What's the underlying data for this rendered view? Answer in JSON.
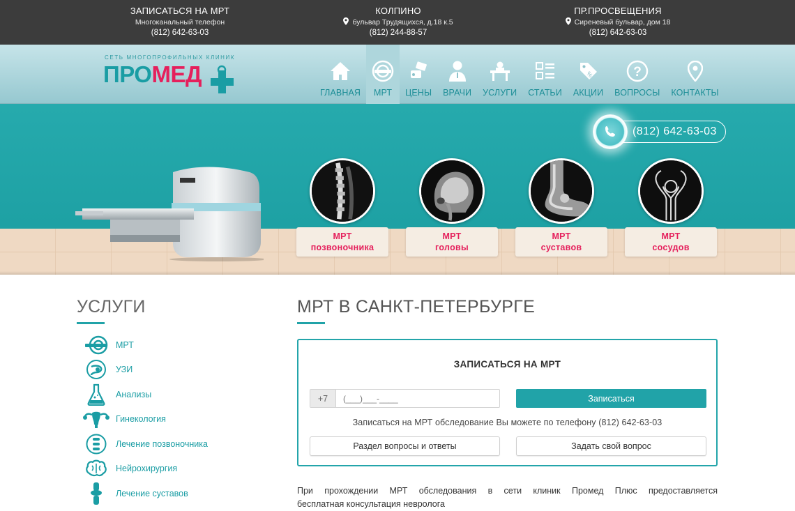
{
  "topbar": {
    "col1": {
      "title": "ЗАПИСАТЬСЯ НА МРТ",
      "line2": "Многоканальный телефон",
      "phone": "(812) 642-63-03"
    },
    "col2": {
      "title": "КОЛПИНО",
      "address": "бульвар Трудящихся, д.18 к.5",
      "phone": "(812) 244-88-57"
    },
    "col3": {
      "title": "ПР.ПРОСВЕЩЕНИЯ",
      "address": "Сиреневый бульвар, дом 18",
      "phone": "(812) 642-63-03"
    }
  },
  "logo": {
    "subtitle": "СЕТЬ МНОГОПРОФИЛЬНЫХ КЛИНИК",
    "part1": "ПРО",
    "part2": "МЕД"
  },
  "nav": {
    "items": [
      {
        "label": "ГЛАВНАЯ",
        "icon": "home-icon"
      },
      {
        "label": "МРТ",
        "icon": "mri-icon",
        "active": true
      },
      {
        "label": "ЦЕНЫ",
        "icon": "price-icon"
      },
      {
        "label": "ВРАЧИ",
        "icon": "doctor-icon"
      },
      {
        "label": "УСЛУГИ",
        "icon": "services-icon"
      },
      {
        "label": "СТАТЬИ",
        "icon": "articles-icon"
      },
      {
        "label": "АКЦИИ",
        "icon": "discount-icon"
      },
      {
        "label": "ВОПРОСЫ",
        "icon": "question-icon"
      },
      {
        "label": "КОНТАКТЫ",
        "icon": "location-icon"
      }
    ]
  },
  "hero": {
    "phone": "(812) 642-63-03",
    "cards": [
      {
        "line1": "МРТ",
        "line2": "позвоночника"
      },
      {
        "line1": "МРТ",
        "line2": "головы"
      },
      {
        "line1": "МРТ",
        "line2": "суставов"
      },
      {
        "line1": "МРТ",
        "line2": "сосудов"
      }
    ]
  },
  "sidebar": {
    "title": "УСЛУГИ",
    "items": [
      {
        "label": "МРТ",
        "icon": "mri-icon"
      },
      {
        "label": "УЗИ",
        "icon": "ultrasound-icon"
      },
      {
        "label": "Анализы",
        "icon": "flask-icon"
      },
      {
        "label": "Гинекология",
        "icon": "uterus-icon"
      },
      {
        "label": "Лечение позвоночника",
        "icon": "spine-icon"
      },
      {
        "label": "Нейрохирургия",
        "icon": "brain-icon"
      },
      {
        "label": "Лечение суставов",
        "icon": "joint-icon"
      }
    ]
  },
  "main": {
    "title": "МРТ В САНКТ-ПЕТЕРБУРГЕ",
    "form": {
      "title": "ЗАПИСАТЬСЯ НА МРТ",
      "prefix": "+7",
      "placeholder": "(___)___-____",
      "submit": "Записаться",
      "note": "Записаться на МРТ обследование Вы можете по телефону (812) 642-63-03",
      "btn_faq": "Раздел вопросы и ответы",
      "btn_ask": "Задать свой вопрос"
    },
    "paragraph": "При прохождении МРТ обследования в сети клиник Промед Плюс предоставляется",
    "paragraph2": "бесплатная консультация невролога"
  },
  "colors": {
    "brand_teal": "#21a3a8",
    "brand_pink": "#e5205c",
    "topbar": "#3c3c3c"
  }
}
